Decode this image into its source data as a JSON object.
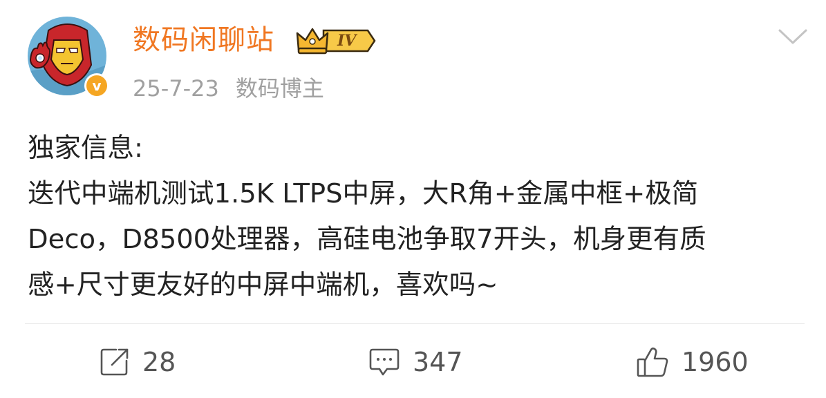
{
  "post": {
    "author": {
      "name": "数码闲聊站",
      "level_label": "IV",
      "verified_mark": "v"
    },
    "meta": {
      "date": "25-7-23",
      "source": "数码博主"
    },
    "content_lines": [
      "独家信息:",
      "迭代中端机测试1.5K LTPS中屏，大R角+金属中框+极简",
      "Deco，D8500处理器，高硅电池争取7开头，机身更有质",
      "感+尺寸更友好的中屏中端机，喜欢吗~"
    ],
    "actions": {
      "repost": {
        "count": "28",
        "icon": "repost-icon"
      },
      "comment": {
        "count": "347",
        "icon": "comment-icon"
      },
      "like": {
        "count": "1960",
        "icon": "thumbs-up-icon"
      }
    }
  },
  "colors": {
    "username": "#f07722",
    "meta": "#a0a0a0",
    "text": "#222222",
    "badge_gold": "#f5a623"
  }
}
